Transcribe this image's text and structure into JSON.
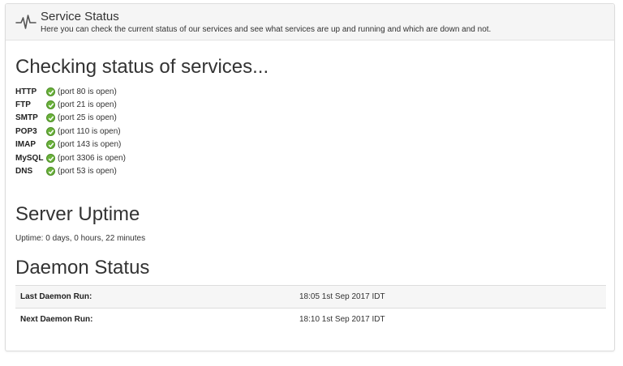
{
  "header": {
    "icon": "pulse-icon",
    "title": "Service Status",
    "subtitle": "Here you can check the current status of our services and see what services are up and running and which are down and not."
  },
  "services_heading": "Checking status of services...",
  "services": [
    {
      "name": "HTTP",
      "status_icon": "check-circle-icon",
      "status": "(port 80 is open)"
    },
    {
      "name": "FTP",
      "status_icon": "check-circle-icon",
      "status": "(port 21 is open)"
    },
    {
      "name": "SMTP",
      "status_icon": "check-circle-icon",
      "status": "(port 25 is open)"
    },
    {
      "name": "POP3",
      "status_icon": "check-circle-icon",
      "status": "(port 110 is open)"
    },
    {
      "name": "IMAP",
      "status_icon": "check-circle-icon",
      "status": "(port 143 is open)"
    },
    {
      "name": "MySQL",
      "status_icon": "check-circle-icon",
      "status": "(port 3306 is open)"
    },
    {
      "name": "DNS",
      "status_icon": "check-circle-icon",
      "status": "(port 53 is open)"
    }
  ],
  "uptime": {
    "heading": "Server Uptime",
    "text": "Uptime: 0 days, 0 hours, 22 minutes"
  },
  "daemon": {
    "heading": "Daemon Status",
    "rows": [
      {
        "label": "Last Daemon Run:",
        "value": "18:05 1st Sep 2017 IDT"
      },
      {
        "label": "Next Daemon Run:",
        "value": "18:10 1st Sep 2017 IDT"
      }
    ]
  },
  "colors": {
    "ok_green": "#6ab23b",
    "header_bg": "#f5f5f5",
    "row_stripe": "#f6f6f6"
  }
}
